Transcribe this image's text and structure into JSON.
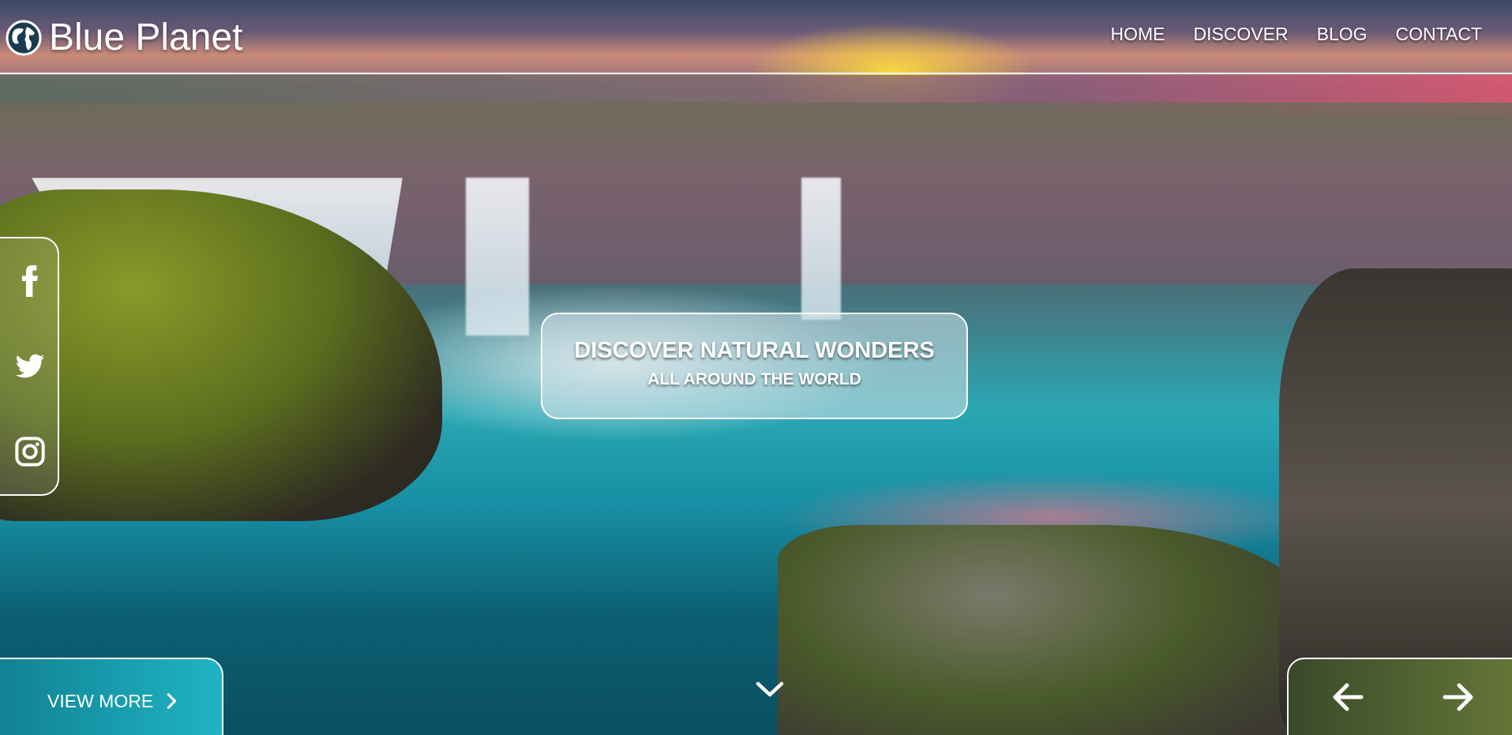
{
  "site": {
    "name": "Blue Planet"
  },
  "nav": {
    "items": [
      "HOME",
      "DISCOVER",
      "BLOG",
      "CONTACT"
    ]
  },
  "hero": {
    "title": "DISCOVER NATURAL WONDERS",
    "subtitle": "ALL AROUND THE WORLD"
  },
  "cta": {
    "label": "VIEW MORE"
  },
  "icons": {
    "logo": "globe-icon",
    "social": [
      "facebook-icon",
      "twitter-icon",
      "instagram-icon"
    ],
    "cta": "chevron-right-icon",
    "scroll": "chevron-down-icon",
    "slider_prev": "arrow-left-icon",
    "slider_next": "arrow-right-icon"
  },
  "colors": {
    "text": "#ffffff",
    "border": "#ffffff"
  }
}
